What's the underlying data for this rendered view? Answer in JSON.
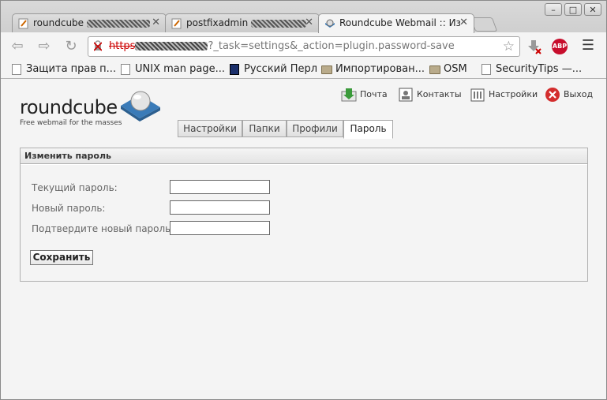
{
  "browser": {
    "tabs": [
      {
        "title": "roundcube"
      },
      {
        "title": "postfixadmin"
      },
      {
        "title": "Roundcube Webmail :: Из"
      }
    ],
    "address": {
      "scheme": "https",
      "path": "?_task=settings&_action=plugin.password-save"
    },
    "bookmarks": [
      {
        "label": "Защита прав п...",
        "icon": "page-icon"
      },
      {
        "label": "UNIX man page...",
        "icon": "page-icon"
      },
      {
        "label": "Русский Перл",
        "icon": "perl-icon"
      },
      {
        "label": "Импортирован...",
        "icon": "folder-icon"
      },
      {
        "label": "OSM",
        "icon": "folder-icon"
      },
      {
        "label": "SecurityTips —...",
        "icon": "page-icon"
      }
    ],
    "abp_label": "ABP"
  },
  "app": {
    "logo_text": "roundcube",
    "logo_tagline": "Free webmail for the masses",
    "topnav": {
      "mail": "Почта",
      "contacts": "Контакты",
      "settings": "Настройки",
      "logout": "Выход"
    },
    "settings_tabs": [
      {
        "label": "Настройки"
      },
      {
        "label": "Папки"
      },
      {
        "label": "Профили"
      },
      {
        "label": "Пароль"
      }
    ],
    "form": {
      "title": "Изменить пароль",
      "current_label": "Текущий пароль:",
      "new_label": "Новый пароль:",
      "confirm_label": "Подтвердите новый пароль:",
      "current_value": "",
      "new_value": "",
      "confirm_value": "",
      "save_label": "Сохранить"
    }
  },
  "colors": {
    "logo_blue": "#3a7bb8",
    "logout_red": "#d32d2d",
    "https_red": "#cc0000"
  }
}
